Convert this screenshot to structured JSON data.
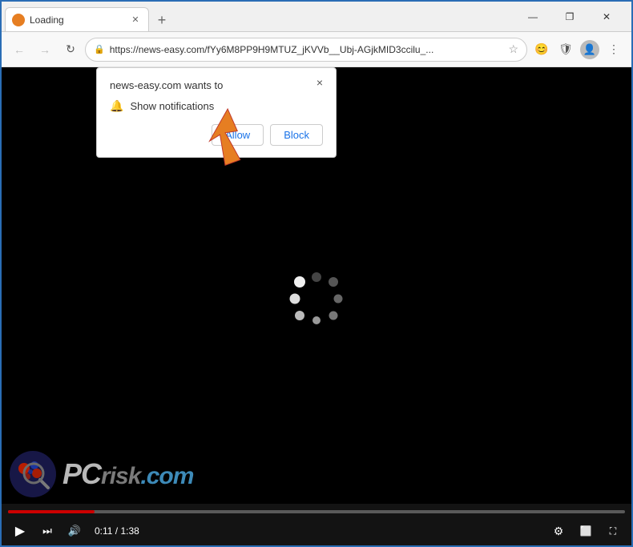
{
  "window": {
    "title": "Loading",
    "controls": {
      "minimize": "—",
      "restore": "❐",
      "close": "✕"
    }
  },
  "tab": {
    "label": "Loading",
    "close": "✕",
    "new_tab": "+"
  },
  "navbar": {
    "back": "←",
    "forward": "→",
    "reload": "↻",
    "url": "https://news-easy.com/fYy6M8PP9H9MTUZ_jKVVb__Ubj-AGjkMID3ccilu_...",
    "url_short": "https://news-easy.com/fYy6M8PP9H9MTUZ_jKVVb__Ubj-AGjkMID3ccilu_...",
    "more": "⋮"
  },
  "popup": {
    "title": "news-easy.com wants to",
    "notification_label": "Show notifications",
    "close": "×",
    "allow_label": "Allow",
    "block_label": "Block"
  },
  "video": {
    "time_current": "0:11",
    "time_total": "1:38",
    "time_display": "0:11 / 1:38",
    "progress_percent": 14
  },
  "spinner_dots": [
    {
      "angle": 0,
      "color": "#555",
      "size": 12
    },
    {
      "angle": 45,
      "color": "#666",
      "size": 12
    },
    {
      "angle": 90,
      "color": "#777",
      "size": 11
    },
    {
      "angle": 135,
      "color": "#888",
      "size": 11
    },
    {
      "angle": 180,
      "color": "#999",
      "size": 10
    },
    {
      "angle": 225,
      "color": "#bbb",
      "size": 12
    },
    {
      "angle": 270,
      "color": "#ddd",
      "size": 13
    },
    {
      "angle": 315,
      "color": "#eee",
      "size": 14
    }
  ],
  "colors": {
    "accent": "#1a73e8",
    "progress": "#cc0000",
    "window_border": "#2a6db5"
  }
}
